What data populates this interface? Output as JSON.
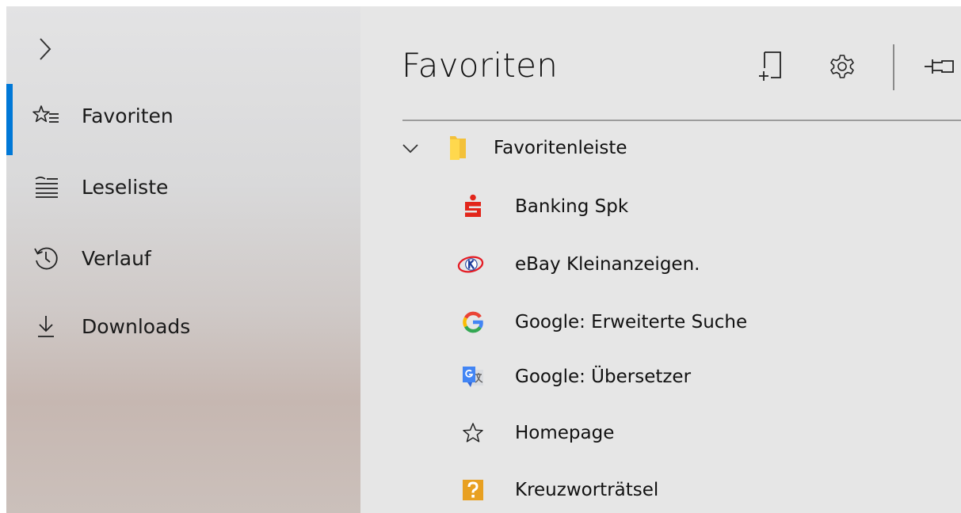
{
  "sidebar": {
    "items": [
      {
        "label": "Favoriten",
        "icon": "favorites-star-list-icon",
        "active": true
      },
      {
        "label": "Leseliste",
        "icon": "reading-list-icon"
      },
      {
        "label": "Verlauf",
        "icon": "history-icon"
      },
      {
        "label": "Downloads",
        "icon": "download-icon"
      }
    ],
    "accent_color": "#0078d7"
  },
  "panel": {
    "title": "Favoriten",
    "toolbar": [
      "add-to-favorites-icon",
      "settings-gear-icon",
      "pin-icon"
    ],
    "folder": {
      "label": "Favoritenleiste",
      "expanded": true,
      "items": [
        {
          "label": "Banking Spk",
          "icon": "sparkasse-icon"
        },
        {
          "label": "eBay Kleinanzeigen.",
          "icon": "ebay-kleinanzeigen-icon"
        },
        {
          "label": "Google: Erweiterte Suche",
          "icon": "google-icon"
        },
        {
          "label": "Google: Übersetzer",
          "icon": "google-translate-icon"
        },
        {
          "label": "Homepage",
          "icon": "star-icon"
        },
        {
          "label": "Kreuzworträtsel",
          "icon": "question-mark-icon"
        }
      ]
    }
  }
}
